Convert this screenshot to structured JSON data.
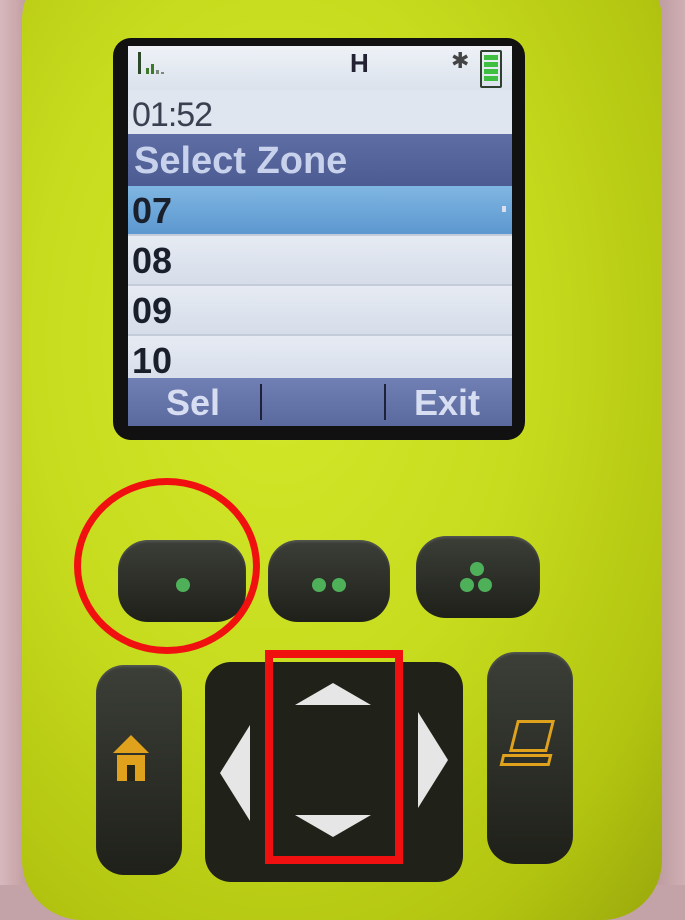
{
  "status_bar": {
    "mode_indicator": "H",
    "icons": [
      "signal-strength-icon",
      "bluetooth-icon",
      "battery-icon"
    ]
  },
  "screen": {
    "time": "01:52",
    "title": "Select Zone",
    "zones": [
      {
        "label": "07",
        "selected": true
      },
      {
        "label": "08",
        "selected": false
      },
      {
        "label": "09",
        "selected": false
      },
      {
        "label": "10",
        "selected": false
      }
    ],
    "softkeys": {
      "left": "Sel",
      "middle": "",
      "right": "Exit"
    }
  },
  "keys": {
    "programmable": [
      "one-dot-button",
      "two-dot-button",
      "three-dot-button"
    ],
    "home": "home-icon",
    "data": "laptop-icon",
    "navigation": [
      "up",
      "down",
      "left",
      "right"
    ]
  },
  "annotations": {
    "circle_color": "#f01010",
    "rect_color": "#f01010"
  },
  "colors": {
    "radio_body": "#c7dc1e",
    "selection_highlight": "#5c97cf",
    "title_bar": "#4c5c92",
    "key_dot": "#4fb05a",
    "key_icon": "#e0a21c"
  }
}
